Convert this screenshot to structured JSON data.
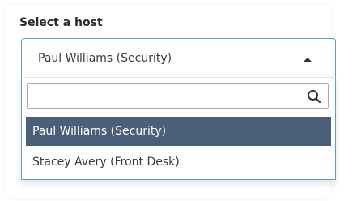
{
  "host_select": {
    "label": "Select a host",
    "selected_value": "Paul Williams (Security)",
    "caret_icon": "caret-up-icon",
    "search": {
      "value": "",
      "placeholder": "",
      "icon": "search-icon"
    },
    "options": [
      {
        "label": "Paul Williams (Security)",
        "selected": true
      },
      {
        "label": "Stacey Avery (Front Desk)",
        "selected": false
      }
    ],
    "colors": {
      "focus_border": "#5b9bd5",
      "selected_option_bg": "#4a5f7a",
      "selected_option_text": "#ffffff"
    }
  }
}
